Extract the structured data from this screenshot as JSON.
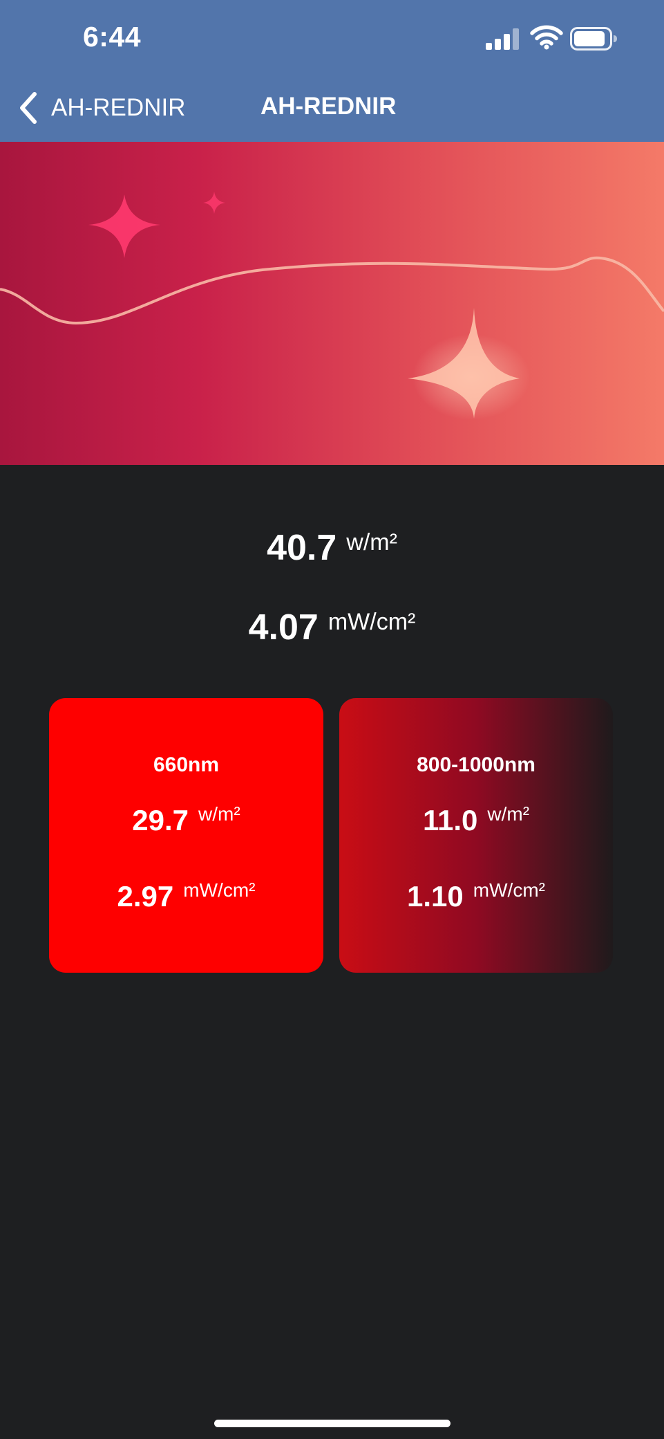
{
  "status_bar": {
    "time": "6:44",
    "icons": [
      "cellular-signal-icon",
      "wifi-icon",
      "battery-icon"
    ]
  },
  "nav": {
    "back_label": "AH-REDNIR",
    "title": "AH-REDNIR",
    "back_icon": "chevron-left-icon"
  },
  "hero": {
    "decorations": [
      "sparkle-icon",
      "sparkle-icon",
      "sparkle-icon",
      "wave-line"
    ]
  },
  "totals": {
    "irradiance_value": "40.7",
    "irradiance_unit": "w/m²",
    "power_density_value": "4.07",
    "power_density_unit": "mW/cm²"
  },
  "cards": [
    {
      "wavelength": "660nm",
      "irradiance_value": "29.7",
      "irradiance_unit": "w/m²",
      "power_density_value": "2.97",
      "power_density_unit": "mW/cm²"
    },
    {
      "wavelength": "800-1000nm",
      "irradiance_value": "11.0",
      "irradiance_unit": "w/m²",
      "power_density_value": "1.10",
      "power_density_unit": "mW/cm²"
    }
  ],
  "colors": {
    "nav_background": "#5275ab",
    "page_background": "#1e1f21",
    "red_card": "#fe0000",
    "ir_card_start": "#c90d15",
    "ir_card_end": "#1f1a1c",
    "hero_start": "#a8163e",
    "hero_end": "#f47a68"
  }
}
